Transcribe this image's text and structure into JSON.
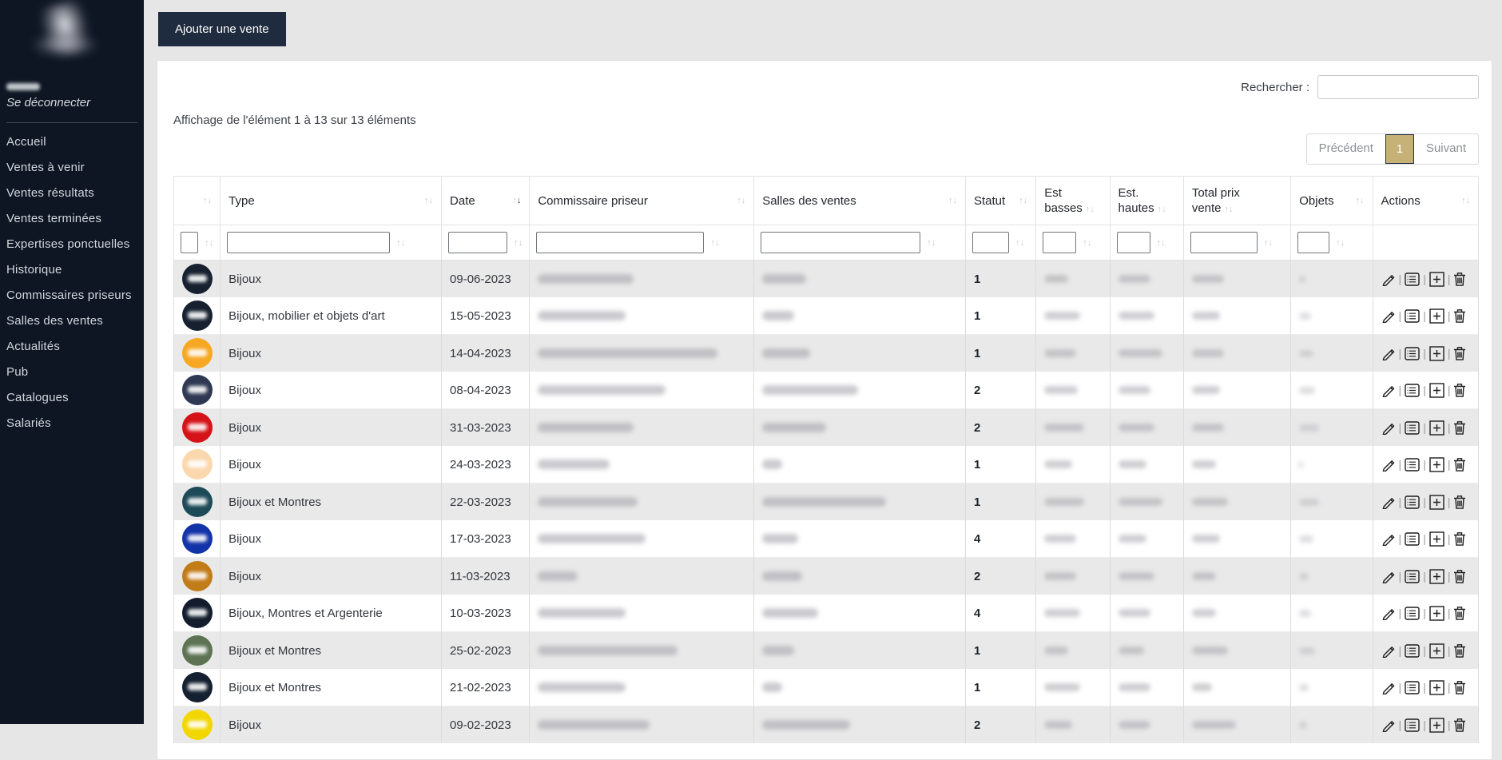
{
  "colors": {
    "sidebar_bg": "#0e1624",
    "accent": "#1f2b3e",
    "gold": "#c6b277",
    "stripe": "#e9e9e9"
  },
  "sidebar": {
    "logout_label": "Se déconnecter",
    "items": [
      "Accueil",
      "Ventes à venir",
      "Ventes résultats",
      "Ventes terminées",
      "Expertises ponctuelles",
      "Historique",
      "Commissaires priseurs",
      "Salles des ventes",
      "Actualités",
      "Pub",
      "Catalogues",
      "Salariés"
    ]
  },
  "toolbar": {
    "add_sale_label": "Ajouter une vente"
  },
  "search": {
    "label": "Rechercher :",
    "value": ""
  },
  "table_info": "Affichage de l'élément 1 à 13 sur 13 éléments",
  "pagination": {
    "previous": "Précédent",
    "current_page": "1",
    "next": "Suivant"
  },
  "table": {
    "columns": [
      {
        "label": "",
        "sort": "none"
      },
      {
        "label": "Type",
        "sort": "none"
      },
      {
        "label": "Date",
        "sort": "desc"
      },
      {
        "label": "Commissaire priseur",
        "sort": "none"
      },
      {
        "label": "Salles des ventes",
        "sort": "none"
      },
      {
        "label": "Statut",
        "sort": "none"
      },
      {
        "label": "Est basses",
        "sort": "none"
      },
      {
        "label": "Est. hautes",
        "sort": "none"
      },
      {
        "label": "Total prix vente",
        "sort": "none"
      },
      {
        "label": "Objets",
        "sort": "none"
      },
      {
        "label": "Actions",
        "sort": "none"
      }
    ],
    "action_icons": [
      {
        "name": "edit-icon",
        "glyph": "pencil"
      },
      {
        "name": "detail-icon",
        "glyph": "list-box"
      },
      {
        "name": "add-icon",
        "glyph": "plus-box"
      },
      {
        "name": "delete-icon",
        "glyph": "trash"
      }
    ],
    "rows": [
      {
        "avatar_color": "#16202f",
        "type": "Bijoux",
        "date": "09-06-2023",
        "statut": "1",
        "redacted": {
          "commissaire": 120,
          "salle": 55,
          "est_basses": 30,
          "est_hautes": 40,
          "total": 40,
          "objets": 8
        }
      },
      {
        "avatar_color": "#16202f",
        "type": "Bijoux, mobilier et objets d'art",
        "date": "15-05-2023",
        "statut": "1",
        "redacted": {
          "commissaire": 110,
          "salle": 40,
          "est_basses": 45,
          "est_hautes": 45,
          "total": 35,
          "objets": 15
        }
      },
      {
        "avatar_color": "#f7a823",
        "type": "Bijoux",
        "date": "14-04-2023",
        "statut": "1",
        "redacted": {
          "commissaire": 225,
          "salle": 60,
          "est_basses": 40,
          "est_hautes": 55,
          "total": 40,
          "objets": 18
        }
      },
      {
        "avatar_color": "#2e3852",
        "type": "Bijoux",
        "date": "08-04-2023",
        "statut": "2",
        "redacted": {
          "commissaire": 160,
          "salle": 120,
          "est_basses": 42,
          "est_hautes": 40,
          "total": 35,
          "objets": 20
        }
      },
      {
        "avatar_color": "#d51217",
        "type": "Bijoux",
        "date": "31-03-2023",
        "statut": "2",
        "redacted": {
          "commissaire": 120,
          "salle": 80,
          "est_basses": 50,
          "est_hautes": 45,
          "total": 40,
          "objets": 25
        }
      },
      {
        "avatar_color": "#fbd7ae",
        "type": "Bijoux",
        "date": "24-03-2023",
        "statut": "1",
        "redacted": {
          "commissaire": 90,
          "salle": 25,
          "est_basses": 35,
          "est_hautes": 35,
          "total": 30,
          "objets": 5
        }
      },
      {
        "avatar_color": "#1c4a57",
        "type": "Bijoux et Montres",
        "date": "22-03-2023",
        "statut": "1",
        "redacted": {
          "commissaire": 125,
          "salle": 155,
          "est_basses": 50,
          "est_hautes": 55,
          "total": 45,
          "objets": 25
        }
      },
      {
        "avatar_color": "#1232a8",
        "type": "Bijoux",
        "date": "17-03-2023",
        "statut": "4",
        "redacted": {
          "commissaire": 135,
          "salle": 45,
          "est_basses": 40,
          "est_hautes": 35,
          "total": 35,
          "objets": 18
        }
      },
      {
        "avatar_color": "#c17b17",
        "type": "Bijoux",
        "date": "11-03-2023",
        "statut": "2",
        "redacted": {
          "commissaire": 50,
          "salle": 50,
          "est_basses": 40,
          "est_hautes": 45,
          "total": 30,
          "objets": 12
        }
      },
      {
        "avatar_color": "#121c2c",
        "type": "Bijoux, Montres et Argenterie",
        "date": "10-03-2023",
        "statut": "4",
        "redacted": {
          "commissaire": 110,
          "salle": 70,
          "est_basses": 45,
          "est_hautes": 40,
          "total": 30,
          "objets": 15
        }
      },
      {
        "avatar_color": "#5d7354",
        "type": "Bijoux et Montres",
        "date": "25-02-2023",
        "statut": "1",
        "redacted": {
          "commissaire": 175,
          "salle": 40,
          "est_basses": 30,
          "est_hautes": 32,
          "total": 45,
          "objets": 20
        }
      },
      {
        "avatar_color": "#14202f",
        "type": "Bijoux et Montres",
        "date": "21-02-2023",
        "statut": "1",
        "redacted": {
          "commissaire": 110,
          "salle": 25,
          "est_basses": 45,
          "est_hautes": 40,
          "total": 25,
          "objets": 12
        }
      },
      {
        "avatar_color": "#f2d600",
        "type": "Bijoux",
        "date": "09-02-2023",
        "statut": "2",
        "redacted": {
          "commissaire": 140,
          "salle": 110,
          "est_basses": 35,
          "est_hautes": 40,
          "total": 55,
          "objets": 10
        }
      }
    ]
  }
}
